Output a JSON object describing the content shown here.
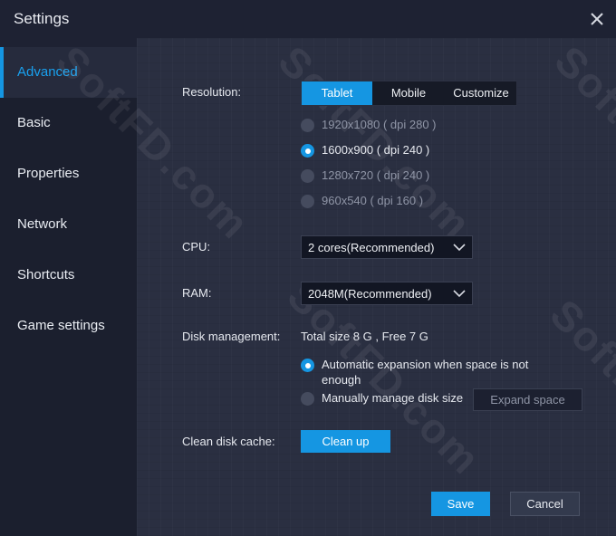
{
  "window": {
    "title": "Settings"
  },
  "sidebar": {
    "items": [
      {
        "label": "Advanced",
        "active": true
      },
      {
        "label": "Basic"
      },
      {
        "label": "Properties"
      },
      {
        "label": "Network"
      },
      {
        "label": "Shortcuts"
      },
      {
        "label": "Game settings"
      }
    ]
  },
  "resolution": {
    "label": "Resolution:",
    "tabs": [
      "Tablet",
      "Mobile",
      "Customize"
    ],
    "selected_tab": "Tablet",
    "options": [
      "1920x1080 ( dpi 280 )",
      "1600x900 ( dpi 240 )",
      "1280x720 ( dpi 240 )",
      "960x540 ( dpi 160 )"
    ],
    "selected_option": "1600x900 ( dpi 240 )"
  },
  "cpu": {
    "label": "CPU:",
    "value": "2 cores(Recommended)"
  },
  "ram": {
    "label": "RAM:",
    "value": "2048M(Recommended)"
  },
  "disk": {
    "label": "Disk management:",
    "summary": "Total size 8 G , Free 7 G",
    "option_auto_line1": "Automatic expansion when space is not",
    "option_auto_line2": "enough",
    "option_manual": "Manually manage disk size",
    "expand_button": "Expand space",
    "selected": "auto"
  },
  "cache": {
    "label": "Clean disk cache:",
    "button": "Clean up"
  },
  "footer": {
    "save": "Save",
    "cancel": "Cancel"
  },
  "watermark": "SoftFD.com",
  "colors": {
    "accent": "#1596e2",
    "active_text": "#19a0ee",
    "panel": "#2a2f41",
    "sidebar": "#1b1f2e"
  }
}
